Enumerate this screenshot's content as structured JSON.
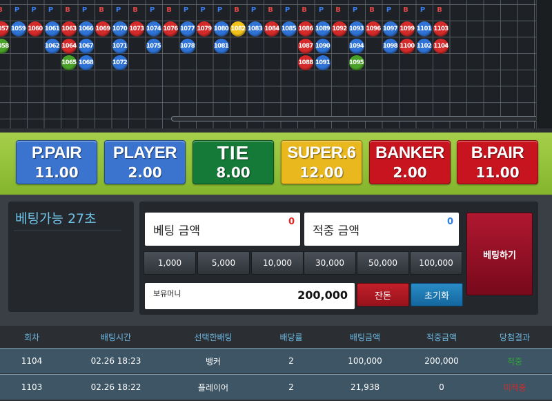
{
  "roadmap": {
    "header_letters": [
      {
        "t": "B",
        "c": "#e04646"
      },
      {
        "t": "P",
        "c": "#3a7ff0"
      },
      {
        "t": "P",
        "c": "#3a7ff0"
      },
      {
        "t": "P",
        "c": "#3a7ff0"
      },
      {
        "t": "B",
        "c": "#e04646"
      },
      {
        "t": "P",
        "c": "#3a7ff0"
      },
      {
        "t": "B",
        "c": "#e04646"
      },
      {
        "t": "P",
        "c": "#3a7ff0"
      },
      {
        "t": "B",
        "c": "#e04646"
      },
      {
        "t": "P",
        "c": "#3a7ff0"
      },
      {
        "t": "B",
        "c": "#e04646"
      },
      {
        "t": "P",
        "c": "#3a7ff0"
      },
      {
        "t": "P",
        "c": "#3a7ff0"
      },
      {
        "t": "P",
        "c": "#3a7ff0"
      },
      {
        "t": "B",
        "c": "#e04646"
      },
      {
        "t": "P",
        "c": "#3a7ff0"
      },
      {
        "t": "B",
        "c": "#e04646"
      },
      {
        "t": "P",
        "c": "#3a7ff0"
      },
      {
        "t": "B",
        "c": "#e04646"
      },
      {
        "t": "P",
        "c": "#3a7ff0"
      },
      {
        "t": "B",
        "c": "#e04646"
      },
      {
        "t": "P",
        "c": "#3a7ff0"
      },
      {
        "t": "B",
        "c": "#e04646"
      },
      {
        "t": "P",
        "c": "#3a7ff0"
      },
      {
        "t": "B",
        "c": "#e04646"
      },
      {
        "t": "P",
        "c": "#3a7ff0"
      },
      {
        "t": "B",
        "c": "#e04646"
      }
    ],
    "beads": [
      {
        "n": "1057",
        "t": "B",
        "r": 0,
        "c": 0
      },
      {
        "n": "1059",
        "t": "P",
        "r": 0,
        "c": 1
      },
      {
        "n": "1060",
        "t": "B",
        "r": 0,
        "c": 2
      },
      {
        "n": "1061",
        "t": "P",
        "r": 0,
        "c": 3
      },
      {
        "n": "1063",
        "t": "B",
        "r": 0,
        "c": 4
      },
      {
        "n": "1066",
        "t": "P",
        "r": 0,
        "c": 5
      },
      {
        "n": "1069",
        "t": "B",
        "r": 0,
        "c": 6
      },
      {
        "n": "1070",
        "t": "P",
        "r": 0,
        "c": 7
      },
      {
        "n": "1073",
        "t": "B",
        "r": 0,
        "c": 8
      },
      {
        "n": "1074",
        "t": "P",
        "r": 0,
        "c": 9
      },
      {
        "n": "1076",
        "t": "B",
        "r": 0,
        "c": 10
      },
      {
        "n": "1077",
        "t": "P",
        "r": 0,
        "c": 11
      },
      {
        "n": "1079",
        "t": "B",
        "r": 0,
        "c": 12
      },
      {
        "n": "1080",
        "t": "P",
        "r": 0,
        "c": 13
      },
      {
        "n": "1082",
        "t": "Y",
        "r": 0,
        "c": 14
      },
      {
        "n": "1083",
        "t": "P",
        "r": 0,
        "c": 15
      },
      {
        "n": "1084",
        "t": "B",
        "r": 0,
        "c": 16
      },
      {
        "n": "1085",
        "t": "P",
        "r": 0,
        "c": 17
      },
      {
        "n": "1086",
        "t": "B",
        "r": 0,
        "c": 18
      },
      {
        "n": "1089",
        "t": "P",
        "r": 0,
        "c": 19
      },
      {
        "n": "1092",
        "t": "B",
        "r": 0,
        "c": 20
      },
      {
        "n": "1093",
        "t": "P",
        "r": 0,
        "c": 21
      },
      {
        "n": "1096",
        "t": "B",
        "r": 0,
        "c": 22
      },
      {
        "n": "1097",
        "t": "P",
        "r": 0,
        "c": 23
      },
      {
        "n": "1099",
        "t": "B",
        "r": 0,
        "c": 24
      },
      {
        "n": "1101",
        "t": "P",
        "r": 0,
        "c": 25
      },
      {
        "n": "1103",
        "t": "B",
        "r": 0,
        "c": 26
      },
      {
        "n": "1058",
        "t": "T",
        "r": 1,
        "c": 0
      },
      {
        "n": "1062",
        "t": "P",
        "r": 1,
        "c": 3
      },
      {
        "n": "1064",
        "t": "B",
        "r": 1,
        "c": 4
      },
      {
        "n": "1067",
        "t": "P",
        "r": 1,
        "c": 5
      },
      {
        "n": "1071",
        "t": "P",
        "r": 1,
        "c": 7
      },
      {
        "n": "1075",
        "t": "P",
        "r": 1,
        "c": 9
      },
      {
        "n": "1078",
        "t": "P",
        "r": 1,
        "c": 11
      },
      {
        "n": "1081",
        "t": "P",
        "r": 1,
        "c": 13
      },
      {
        "n": "1087",
        "t": "B",
        "r": 1,
        "c": 18
      },
      {
        "n": "1090",
        "t": "P",
        "r": 1,
        "c": 19
      },
      {
        "n": "1094",
        "t": "P",
        "r": 1,
        "c": 21
      },
      {
        "n": "1098",
        "t": "P",
        "r": 1,
        "c": 23
      },
      {
        "n": "1100",
        "t": "B",
        "r": 1,
        "c": 24
      },
      {
        "n": "1102",
        "t": "P",
        "r": 1,
        "c": 25
      },
      {
        "n": "1104",
        "t": "B",
        "r": 1,
        "c": 26
      },
      {
        "n": "1065",
        "t": "T",
        "r": 2,
        "c": 4
      },
      {
        "n": "1068",
        "t": "P",
        "r": 2,
        "c": 5
      },
      {
        "n": "1072",
        "t": "P",
        "r": 2,
        "c": 7
      },
      {
        "n": "1088",
        "t": "B",
        "r": 2,
        "c": 18
      },
      {
        "n": "1091",
        "t": "P",
        "r": 2,
        "c": 19
      },
      {
        "n": "1095",
        "t": "T",
        "r": 2,
        "c": 21
      }
    ],
    "colors": {
      "P": "#2f73d6",
      "B": "#d42a2a",
      "T": "#4aa329",
      "Y": "#f2c21b"
    }
  },
  "bet_options": [
    {
      "name": "P.PAIR",
      "odds": "11.00",
      "color": "#3a74cf"
    },
    {
      "name": "PLAYER",
      "odds": "2.00",
      "color": "#3a74cf"
    },
    {
      "name": "TIE",
      "odds": "8.00",
      "color": "#157a38"
    },
    {
      "name": "SUPER.6",
      "odds": "12.00",
      "color": "#e9b81f"
    },
    {
      "name": "BANKER",
      "odds": "2.00",
      "color": "#c8141e"
    },
    {
      "name": "B.PAIR",
      "odds": "11.00",
      "color": "#c8141e"
    }
  ],
  "timer": {
    "text": "베팅가능 27초"
  },
  "bet_form": {
    "bet_amount_label": "베팅 금액",
    "bet_amount_value": "0",
    "win_amount_label": "적중 금액",
    "win_amount_value": "0",
    "chips": [
      "1,000",
      "5,000",
      "10,000",
      "30,000",
      "50,000",
      "100,000"
    ],
    "balance_label": "보유머니",
    "balance_value": "200,000",
    "change_label": "잔돈",
    "reset_label": "초기화",
    "place_bet_label": "베팅하기"
  },
  "history": {
    "headers": [
      "회차",
      "배팅시간",
      "선택한배팅",
      "배당률",
      "배팅금액",
      "적중금액",
      "당첨결과"
    ],
    "rows": [
      [
        "1104",
        "02.26 18:23",
        "뱅커",
        "2",
        "100,000",
        "200,000",
        "적중"
      ],
      [
        "1103",
        "02.26 18:22",
        "플레이어",
        "2",
        "21,938",
        "0",
        "미적중"
      ]
    ],
    "result_colors": {
      "적중": "#2fa437",
      "미적중": "#d42a2a"
    }
  }
}
